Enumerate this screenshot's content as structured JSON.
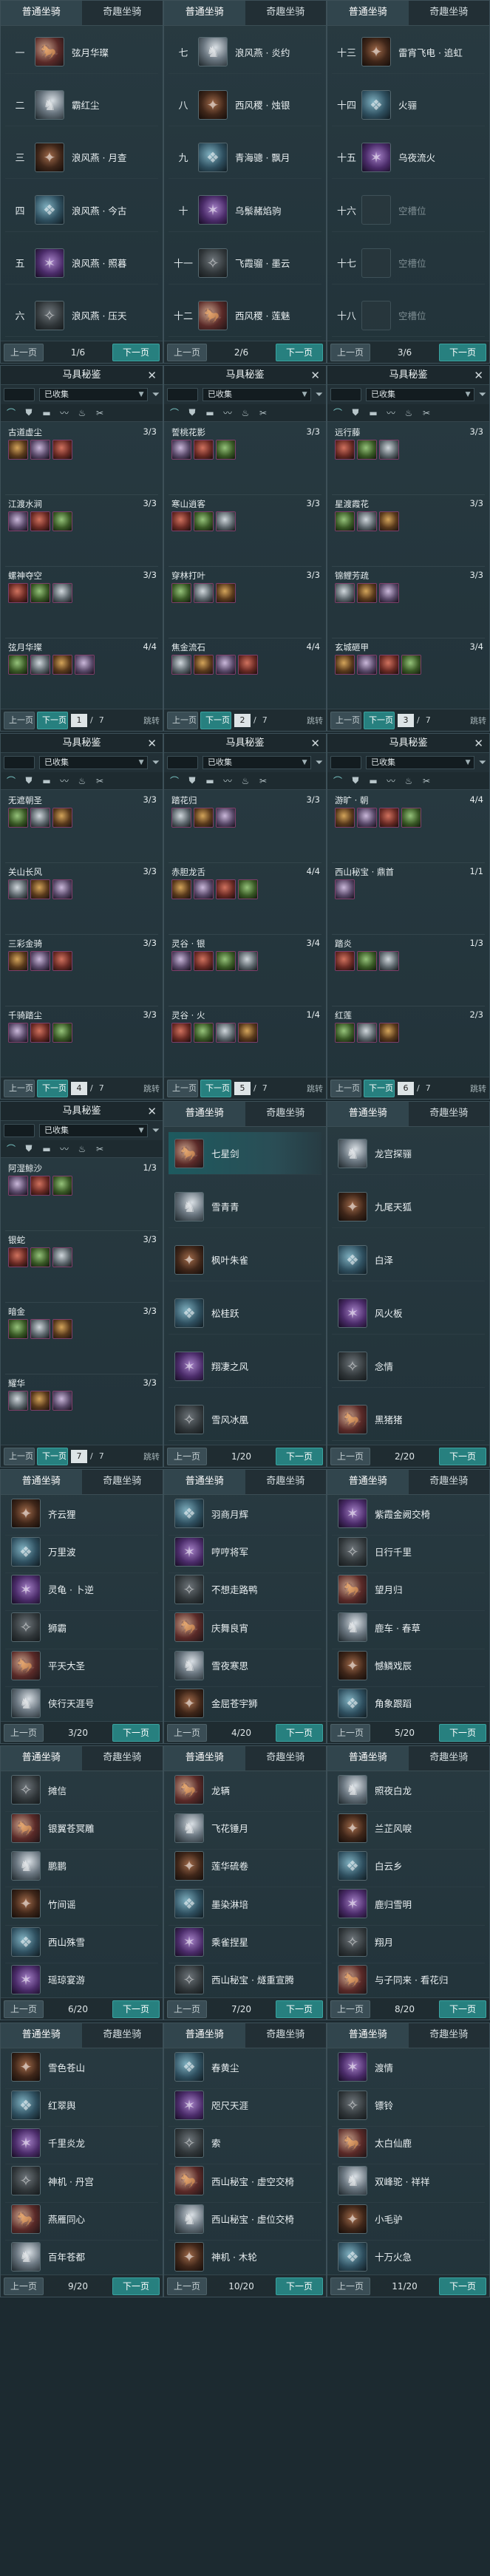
{
  "labels": {
    "tab_common": "普通坐骑",
    "tab_rare": "奇趣坐骑",
    "prev": "上一页",
    "next": "下一页",
    "tack_title": "马具秘鉴",
    "filter_collected": "已收集",
    "jump": "跳转",
    "close": "✕"
  },
  "mount_pages": [
    {
      "page": "1/6",
      "rows": [
        [
          "一",
          "弦月华璨"
        ],
        [
          "二",
          "霸红尘"
        ],
        [
          "三",
          "浪风燕 · 月查"
        ],
        [
          "四",
          "浪风燕 · 今古"
        ],
        [
          "五",
          "浪风燕 · 照暮"
        ],
        [
          "六",
          "浪风燕 · 压天"
        ]
      ]
    },
    {
      "page": "2/6",
      "rows": [
        [
          "七",
          "浪风燕 · 炎约"
        ],
        [
          "八",
          "西风稷 · 烛银"
        ],
        [
          "九",
          "青海骢 · 飘月"
        ],
        [
          "十",
          "乌鬃赭焰驹"
        ],
        [
          "十一",
          "飞霞骝 · 墨云"
        ],
        [
          "十二",
          "西风稷 · 莲魅"
        ]
      ]
    },
    {
      "page": "3/6",
      "rows": [
        [
          "十三",
          "雷宵飞电 · 追虹"
        ],
        [
          "十四",
          "火骊"
        ],
        [
          "十五",
          "乌夜流火"
        ],
        [
          "十六",
          "空槽位"
        ],
        [
          "十七",
          "空槽位"
        ],
        [
          "十八",
          "空槽位"
        ]
      ]
    }
  ],
  "tack_pages": [
    {
      "page": "1",
      "total": "7",
      "groups": [
        [
          "古道虚尘",
          "3/3"
        ],
        [
          "江渡水涧",
          "3/3"
        ],
        [
          "螺神夺空",
          "3/3"
        ],
        [
          "弦月华璨",
          "4/4"
        ]
      ]
    },
    {
      "page": "2",
      "total": "7",
      "groups": [
        [
          "誓桃花影",
          "3/3"
        ],
        [
          "寒山逍客",
          "3/3"
        ],
        [
          "穿林打叶",
          "3/3"
        ],
        [
          "焦金流石",
          "4/4"
        ]
      ]
    },
    {
      "page": "3",
      "total": "7",
      "groups": [
        [
          "远行藤",
          "3/3"
        ],
        [
          "星渡霞花",
          "3/3"
        ],
        [
          "锦鲤芳疏",
          "3/3"
        ],
        [
          "玄城砸甲",
          "3/4"
        ]
      ]
    },
    {
      "page": "4",
      "total": "7",
      "groups": [
        [
          "无遮朝圣",
          "3/3"
        ],
        [
          "关山长风",
          "3/3"
        ],
        [
          "三彩金骑",
          "3/3"
        ],
        [
          "千骑踏尘",
          "3/3"
        ]
      ]
    },
    {
      "page": "5",
      "total": "7",
      "groups": [
        [
          "踏花归",
          "3/3"
        ],
        [
          "赤胆龙舌",
          "4/4"
        ],
        [
          "灵谷 · 银",
          "3/4"
        ],
        [
          "灵谷 · 火",
          "1/4"
        ]
      ]
    },
    {
      "page": "6",
      "total": "7",
      "groups": [
        [
          "游旷 · 朝",
          "4/4"
        ],
        [
          "西山秘宝 · 鼎首",
          "1/1"
        ],
        [
          "踏炎",
          "1/3"
        ],
        [
          "红莲",
          "2/3"
        ]
      ]
    },
    {
      "page": "7",
      "total": "7",
      "groups": [
        [
          "阿湿鲸沙",
          "1/3"
        ],
        [
          "银蛇",
          "3/3"
        ],
        [
          "暗金",
          "3/3"
        ],
        [
          "耀华",
          "3/3"
        ]
      ]
    }
  ],
  "rare_pages": [
    {
      "page": "1/20",
      "rows": [
        "七星剑",
        "雪青青",
        "枫叶朱雀",
        "松桂跃",
        "翔凄之风",
        "雪风冰凰"
      ]
    },
    {
      "page": "2/20",
      "rows": [
        "龙宫探骊",
        "九尾天狐",
        "白泽",
        "风火板",
        "念情",
        "黑猪猪"
      ]
    },
    {
      "page": "3/20",
      "rows": [
        "齐云狸",
        "万里波",
        "灵龟 · 卜逆",
        "狮霸",
        "平天大圣",
        "侠行天涯号"
      ]
    },
    {
      "page": "4/20",
      "rows": [
        "羽商月辉",
        "哼哼将军",
        "不想走路鸭",
        "庆舞良宵",
        "雪夜寒思",
        "金屈苍宇狮"
      ]
    },
    {
      "page": "5/20",
      "rows": [
        "紫霞金阙交椅",
        "日行千里",
        "望月归",
        "鹿车 · 春草",
        "憾鳞戏辰",
        "角象跟蹈"
      ]
    },
    {
      "page": "6/20",
      "rows": [
        "摊信",
        "银翼苍冥雕",
        "鹏鹏",
        "竹间谣",
        "西山殊雪",
        "瑶琼宴游"
      ]
    },
    {
      "page": "7/20",
      "rows": [
        "龙辆",
        "飞花锤月",
        "莲华硫卷",
        "墨染淋培",
        "乘雀捏星",
        "西山秘宝 · 燧重宣腾"
      ]
    },
    {
      "page": "8/20",
      "rows": [
        "照夜白龙",
        "兰芷风唳",
        "白云乡",
        "鹿归雪明",
        "翔月",
        "与子同来 · 看花归"
      ]
    },
    {
      "page": "9/20",
      "rows": [
        "雪色苍山",
        "红翠舆",
        "千里炎龙",
        "神机 · 丹宫",
        "燕雁同心",
        "百年苍都"
      ]
    },
    {
      "page": "10/20",
      "rows": [
        "春黄尘",
        "咫尺天涯",
        "索",
        "西山秘宝 · 虚空交椅",
        "西山秘宝 · 虚位交椅",
        "神机 · 木轮"
      ]
    },
    {
      "page": "11/20",
      "rows": [
        "渡情",
        "镖铃",
        "太白仙鹿",
        "双峰驼 · 祥祥",
        "小毛驴",
        "十万火急"
      ]
    }
  ]
}
